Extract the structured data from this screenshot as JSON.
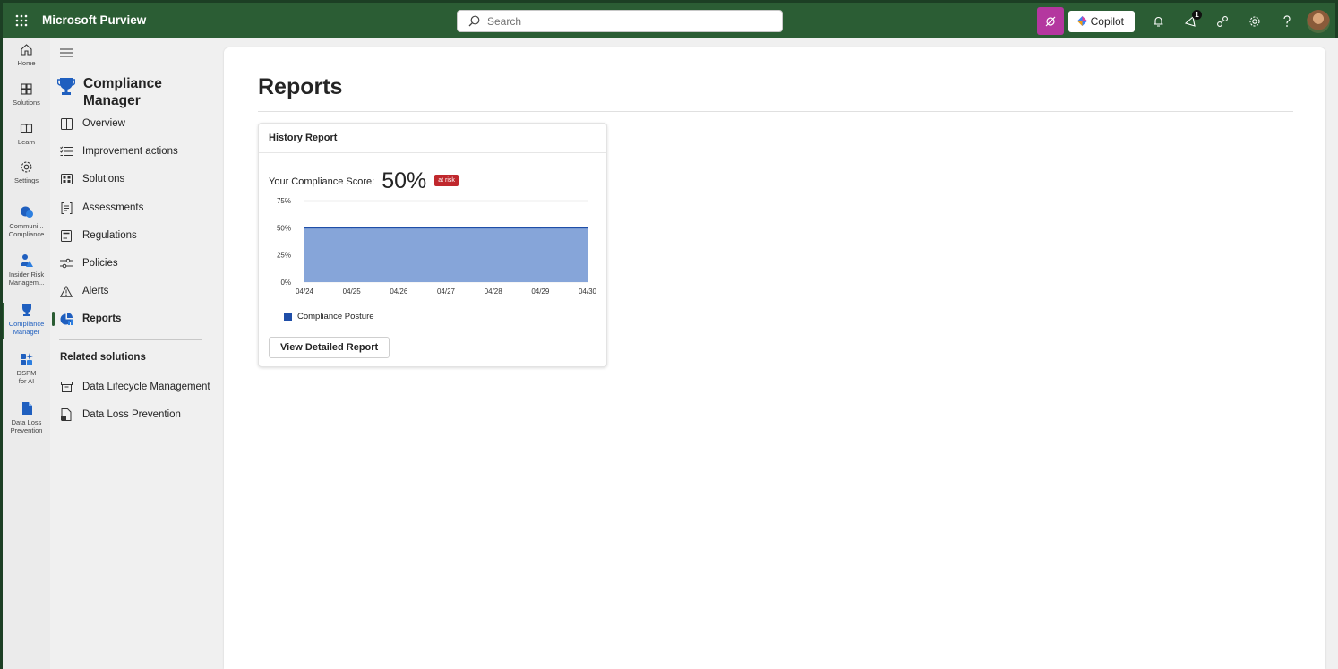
{
  "app": {
    "title": "Microsoft Purview"
  },
  "search": {
    "placeholder": "Search"
  },
  "toolbar": {
    "copilot_label": "Copilot",
    "notification_count": "1"
  },
  "rail": {
    "items": [
      {
        "label": "Home"
      },
      {
        "label": "Solutions"
      },
      {
        "label": "Learn"
      },
      {
        "label": "Settings"
      },
      {
        "label": "Communi... Compliance"
      },
      {
        "label": "Insider Risk Managem..."
      },
      {
        "label": "Compliance Manager"
      },
      {
        "label": "DSPM for AI"
      },
      {
        "label": "Data Loss Prevention"
      }
    ]
  },
  "nav": {
    "title": "Compliance Manager",
    "items": [
      {
        "label": "Overview"
      },
      {
        "label": "Improvement actions"
      },
      {
        "label": "Solutions"
      },
      {
        "label": "Assessments"
      },
      {
        "label": "Regulations"
      },
      {
        "label": "Policies"
      },
      {
        "label": "Alerts"
      },
      {
        "label": "Reports"
      }
    ],
    "related_heading": "Related solutions",
    "related": [
      {
        "label": "Data Lifecycle Management"
      },
      {
        "label": "Data Loss Prevention"
      }
    ]
  },
  "main": {
    "title": "Reports",
    "card": {
      "title": "History Report",
      "score_label": "Your Compliance Score:",
      "score_value": "50%",
      "risk_badge": "at risk",
      "button_label": "View Detailed Report"
    }
  },
  "colors": {
    "header": "#2b5d34",
    "accent_pink": "#b4379f",
    "risk": "#c0282d",
    "series": "#1f4ea8"
  },
  "chart_data": {
    "type": "area",
    "x": [
      "04/24",
      "04/25",
      "04/26",
      "04/27",
      "04/28",
      "04/29",
      "04/30"
    ],
    "series": [
      {
        "name": "Compliance Posture",
        "values": [
          50,
          50,
          50,
          50,
          50,
          50,
          50
        ]
      }
    ],
    "yticks": [
      "0%",
      "25%",
      "50%",
      "75%"
    ],
    "ylim": [
      0,
      75
    ],
    "legend": "bottom-left",
    "grid": true
  }
}
